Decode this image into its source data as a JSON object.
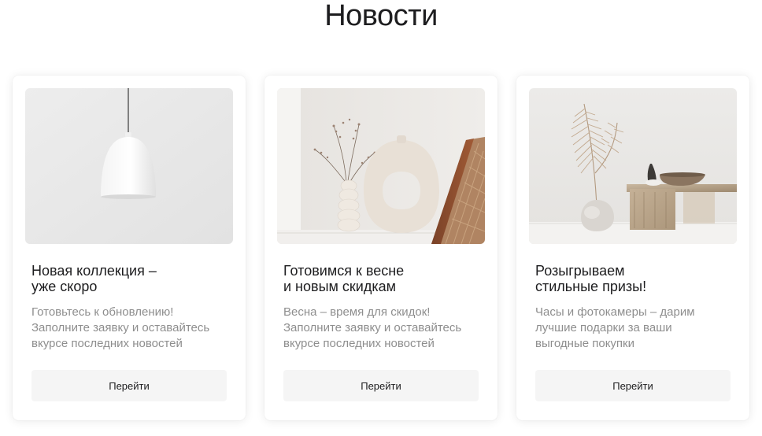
{
  "page": {
    "heading": "Новости"
  },
  "cards": [
    {
      "image_icon": "pendant-lamp-photo",
      "title_lines": [
        "Новая коллекция –",
        "уже скоро"
      ],
      "desc_lines": [
        "Готовьтесь к обновлению!",
        "Заполните заявку и оставайтесь",
        "вкурсе последних новостей"
      ],
      "button_label": "Перейти"
    },
    {
      "image_icon": "ring-vase-photo",
      "title_lines": [
        "Готовимся к весне",
        "и новым скидкам"
      ],
      "desc_lines": [
        "Весна – время для скидок!",
        "Заполните заявку и оставайтесь",
        "вкурсе последних новостей"
      ],
      "button_label": "Перейти"
    },
    {
      "image_icon": "dried-palm-vase-photo",
      "title_lines": [
        "Розыгрываем",
        "стильные призы!"
      ],
      "desc_lines": [
        "Часы и фотокамеры – дарим",
        "лучшие подарки за ваши",
        "выгодные покупки"
      ],
      "button_label": "Перейти"
    }
  ]
}
